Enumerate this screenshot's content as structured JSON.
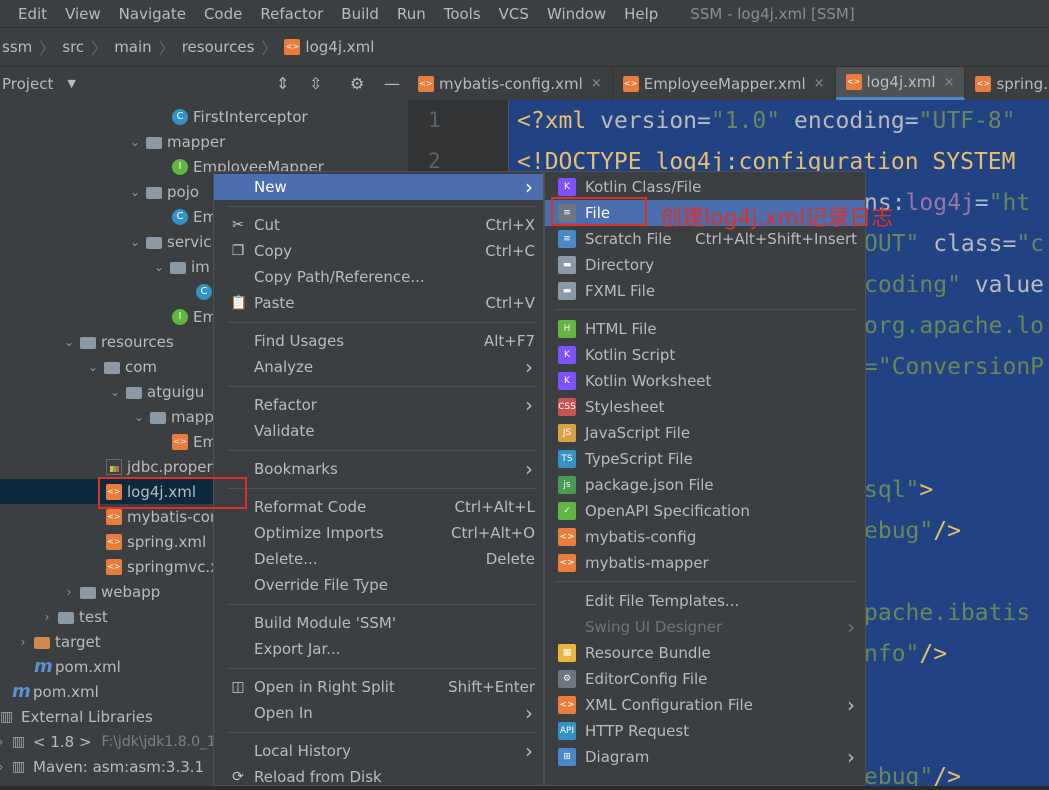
{
  "menubar": {
    "items": [
      "Edit",
      "View",
      "Navigate",
      "Code",
      "Refactor",
      "Build",
      "Run",
      "Tools",
      "VCS",
      "Window",
      "Help"
    ],
    "window_title": "SSM - log4j.xml [SSM]"
  },
  "breadcrumb": [
    "ssm",
    "src",
    "main",
    "resources",
    "log4j.xml"
  ],
  "project_panel": {
    "title": "Project"
  },
  "tree": [
    {
      "label": "FirstInterceptor",
      "icon": "class-icon"
    },
    {
      "label": "mapper",
      "icon": "package-icon"
    },
    {
      "label": "EmployeeMapper",
      "icon": "interface-icon"
    },
    {
      "label": "pojo",
      "icon": "package-icon"
    },
    {
      "label": "Em",
      "icon": "class-icon"
    },
    {
      "label": "servic",
      "icon": "package-icon"
    },
    {
      "label": "im",
      "icon": "package-icon"
    },
    {
      "label": "",
      "icon": "class-icon"
    },
    {
      "label": "Em",
      "icon": "interface-icon"
    },
    {
      "label": "resources",
      "icon": "resources-folder-icon"
    },
    {
      "label": "com",
      "icon": "folder-icon"
    },
    {
      "label": "atguigu",
      "icon": "folder-icon"
    },
    {
      "label": "mapp",
      "icon": "folder-icon"
    },
    {
      "label": "Em",
      "icon": "xml-file-icon"
    },
    {
      "label": "jdbc.proper",
      "icon": "properties-file-icon"
    },
    {
      "label": "log4j.xml",
      "icon": "xml-file-icon"
    },
    {
      "label": "mybatis-cor",
      "icon": "xml-file-icon"
    },
    {
      "label": "spring.xml",
      "icon": "xml-file-icon"
    },
    {
      "label": "springmvc.x",
      "icon": "xml-file-icon"
    },
    {
      "label": "webapp",
      "icon": "folder-icon"
    },
    {
      "label": "test",
      "icon": "folder-icon"
    },
    {
      "label": "target",
      "icon": "excluded-folder-icon"
    },
    {
      "label": "pom.xml",
      "icon": "maven-icon"
    },
    {
      "label": "pom.xml",
      "icon": "maven-icon"
    },
    {
      "label": "External Libraries",
      "icon": "libraries-icon"
    },
    {
      "label": "< 1.8 >",
      "icon": "jdk-icon",
      "extra": "F:\\jdk\\jdk1.8.0_1"
    },
    {
      "label": "Maven: asm:asm:3.3.1",
      "icon": "library-icon"
    }
  ],
  "tabs": [
    {
      "label": "mybatis-config.xml",
      "active": false
    },
    {
      "label": "EmployeeMapper.xml",
      "active": false
    },
    {
      "label": "log4j.xml",
      "active": true
    },
    {
      "label": "spring.",
      "active": false
    }
  ],
  "editor": {
    "line_numbers": [
      "1",
      "2"
    ],
    "lines": [
      [
        {
          "t": "<?xml ",
          "c": "kw"
        },
        {
          "t": "version",
          "c": "at"
        },
        {
          "t": "=",
          "c": "tx"
        },
        {
          "t": "\"1.0\"",
          "c": "st"
        },
        {
          "t": " encoding",
          "c": "at"
        },
        {
          "t": "=",
          "c": "tx"
        },
        {
          "t": "\"UTF-8\"",
          "c": "st"
        }
      ],
      [
        {
          "t": "<!DOCTYPE log4j:configuration SYSTEM",
          "c": "kw"
        }
      ],
      [
        {
          "t": "ns:",
          "c": "at"
        },
        {
          "t": "log4j",
          "c": "ns"
        },
        {
          "t": "=",
          "c": "tx"
        },
        {
          "t": "\"ht",
          "c": "st"
        }
      ],
      [
        {
          "t": "OUT\"",
          "c": "st"
        },
        {
          "t": " class",
          "c": "at"
        },
        {
          "t": "=",
          "c": "tx"
        },
        {
          "t": "\"c",
          "c": "st"
        }
      ],
      [
        {
          "t": "coding\"",
          "c": "st"
        },
        {
          "t": " value",
          "c": "at"
        }
      ],
      [
        {
          "t": "org.apache.lo",
          "c": "st"
        }
      ],
      [
        {
          "t": "=\"ConversionP",
          "c": "st"
        }
      ],
      [
        {
          "t": "sql\"",
          "c": "st"
        },
        {
          "t": ">",
          "c": "kw"
        }
      ],
      [
        {
          "t": "ebug\"",
          "c": "st"
        },
        {
          "t": "/>",
          "c": "kw"
        }
      ],
      [
        {
          "t": "pache.ibatis",
          "c": "st"
        }
      ],
      [
        {
          "t": "nfo\"",
          "c": "st"
        },
        {
          "t": "/>",
          "c": "kw"
        }
      ],
      [
        {
          "t": "ebug\"",
          "c": "st"
        },
        {
          "t": "/>",
          "c": "kw"
        }
      ]
    ]
  },
  "context_menu": [
    {
      "label": "New",
      "shortcut": "",
      "submenu": true,
      "icon": "",
      "highlight": true
    },
    {
      "sep": true
    },
    {
      "label": "Cut",
      "shortcut": "Ctrl+X",
      "icon": "scissors-icon"
    },
    {
      "label": "Copy",
      "shortcut": "Ctrl+C",
      "icon": "copy-icon"
    },
    {
      "label": "Copy Path/Reference...",
      "shortcut": ""
    },
    {
      "label": "Paste",
      "shortcut": "Ctrl+V",
      "icon": "paste-icon"
    },
    {
      "sep": true
    },
    {
      "label": "Find Usages",
      "shortcut": "Alt+F7"
    },
    {
      "label": "Analyze",
      "submenu": true
    },
    {
      "sep": true
    },
    {
      "label": "Refactor",
      "submenu": true
    },
    {
      "label": "Validate"
    },
    {
      "sep": true
    },
    {
      "label": "Bookmarks",
      "submenu": true
    },
    {
      "sep": true
    },
    {
      "label": "Reformat Code",
      "shortcut": "Ctrl+Alt+L"
    },
    {
      "label": "Optimize Imports",
      "shortcut": "Ctrl+Alt+O"
    },
    {
      "label": "Delete...",
      "shortcut": "Delete"
    },
    {
      "label": "Override File Type"
    },
    {
      "sep": true
    },
    {
      "label": "Build Module 'SSM'"
    },
    {
      "label": "Export Jar..."
    },
    {
      "sep": true
    },
    {
      "label": "Open in Right Split",
      "shortcut": "Shift+Enter",
      "icon": "split-icon"
    },
    {
      "label": "Open In",
      "submenu": true
    },
    {
      "sep": true
    },
    {
      "label": "Local History",
      "submenu": true
    },
    {
      "label": "Reload from Disk",
      "icon": "reload-icon"
    }
  ],
  "new_submenu": [
    {
      "label": "Kotlin Class/File",
      "icon": "K",
      "color": "#7f52ff"
    },
    {
      "label": "File",
      "icon": "≡",
      "color": "#6e7681",
      "highlight": true
    },
    {
      "label": "Scratch File",
      "shortcut": "Ctrl+Alt+Shift+Insert",
      "icon": "≡",
      "color": "#4a88c7"
    },
    {
      "label": "Directory",
      "icon": "▬",
      "color": "#8b99a6"
    },
    {
      "label": "FXML File",
      "icon": "▬",
      "color": "#8b99a6"
    },
    {
      "sep": true
    },
    {
      "label": "HTML File",
      "icon": "H",
      "color": "#62b543"
    },
    {
      "label": "Kotlin Script",
      "icon": "K",
      "color": "#7f52ff"
    },
    {
      "label": "Kotlin Worksheet",
      "icon": "K",
      "color": "#7f52ff"
    },
    {
      "label": "Stylesheet",
      "icon": "CSS",
      "color": "#c75450"
    },
    {
      "label": "JavaScript File",
      "icon": "JS",
      "color": "#d9a343"
    },
    {
      "label": "TypeScript File",
      "icon": "TS",
      "color": "#3592c4"
    },
    {
      "label": "package.json File",
      "icon": "js",
      "color": "#499c54"
    },
    {
      "label": "OpenAPI Specification",
      "icon": "✓",
      "color": "#62b543"
    },
    {
      "label": "mybatis-config",
      "icon": "<>",
      "color": "#e87d3e"
    },
    {
      "label": "mybatis-mapper",
      "icon": "<>",
      "color": "#e87d3e"
    },
    {
      "sep": true
    },
    {
      "label": "Edit File Templates..."
    },
    {
      "label": "Swing UI Designer",
      "disabled": true,
      "submenu": true
    },
    {
      "label": "Resource Bundle",
      "icon": "▦",
      "color": "#e8b63e"
    },
    {
      "label": "EditorConfig File",
      "icon": "⚙",
      "color": "#6e7681"
    },
    {
      "label": "XML Configuration File",
      "icon": "<>",
      "color": "#e87d3e",
      "submenu": true
    },
    {
      "label": "HTTP Request",
      "icon": "API",
      "color": "#3592c4"
    },
    {
      "label": "Diagram",
      "icon": "⊞",
      "color": "#4a88c7",
      "submenu": true
    }
  ],
  "annotation": "创建log4j.xml记录日志",
  "colors": {
    "accent": "#4b6eaf",
    "annotation_red": "#e0302a"
  }
}
